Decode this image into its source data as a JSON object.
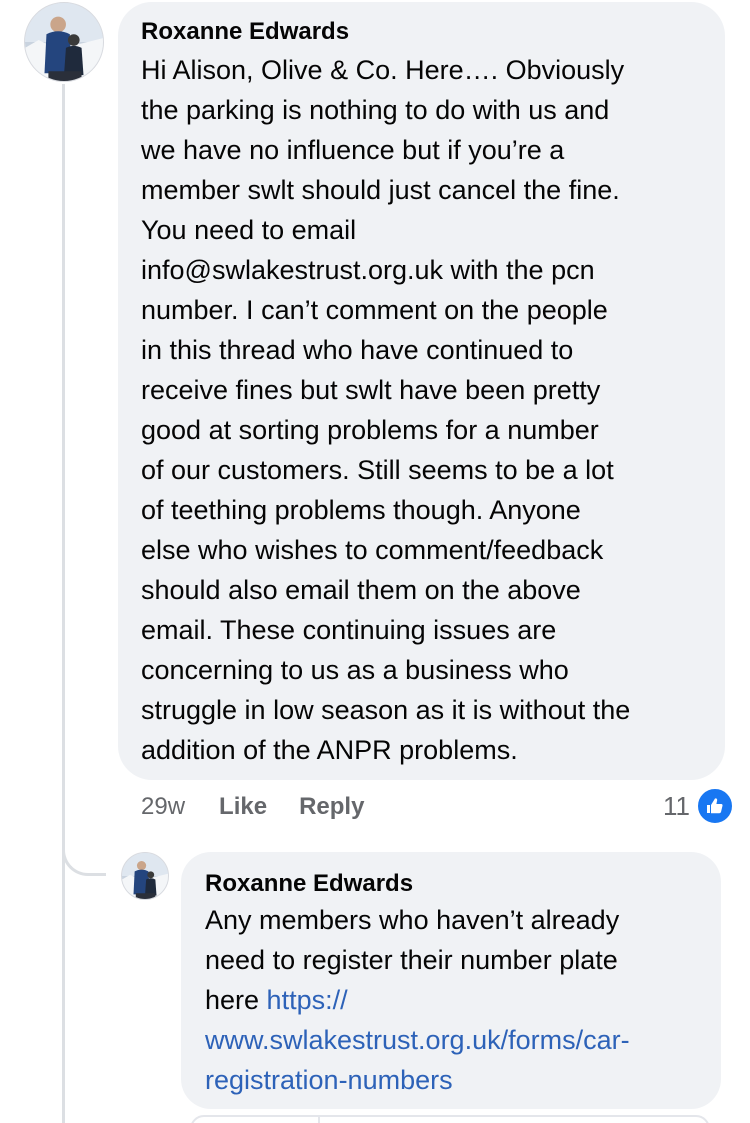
{
  "comment": {
    "author": "Roxanne Edwards",
    "text": "Hi Alison, Olive & Co. Here…. Obviously\nthe parking is nothing to do with us and\nwe have no influence but if you’re a\nmember swlt should just cancel the fine.\nYou need to email\ninfo@swlakestrust.org.uk with the pcn\nnumber. I can’t comment on the people\nin this thread who have continued to\nreceive fines but swlt have been pretty\ngood at sorting problems for a number\nof our customers. Still seems to be a lot\nof teething problems though. Anyone\nelse who wishes to comment/feedback\nshould also email them on the above\nemail. These continuing issues are\nconcerning to us as a business who\nstruggle in low season as it is without the\naddition of the ANPR problems.",
    "time": "29w",
    "like_label": "Like",
    "reply_label": "Reply",
    "reaction_count": "11",
    "reaction_icon": "thumbs-up-icon"
  },
  "reply": {
    "author": "Roxanne Edwards",
    "text": "Any members who haven’t already\nneed to register their number plate\nhere ",
    "link": "https://\nwww.swlakestrust.org.uk/forms/car-\nregistration-numbers"
  },
  "colors": {
    "bubble": "#f0f2f5",
    "link": "#2d62b8",
    "meta": "#65676b",
    "like_blue": "#1877f2"
  }
}
